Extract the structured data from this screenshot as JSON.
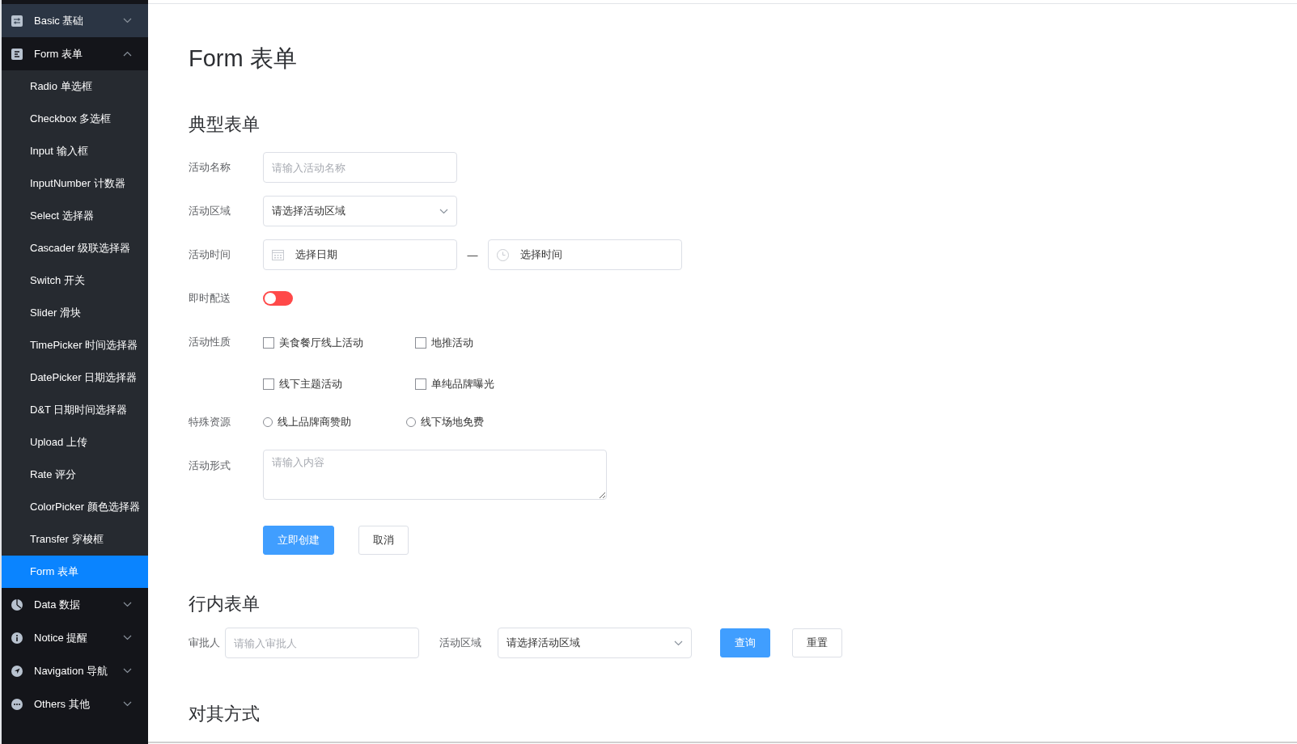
{
  "sidebar": {
    "groups": [
      {
        "label": "Basic 基础",
        "expanded": false
      },
      {
        "label": "Form 表单",
        "expanded": true,
        "children": [
          {
            "label": "Radio 单选框",
            "selected": false
          },
          {
            "label": "Checkbox 多选框",
            "selected": false
          },
          {
            "label": "Input 输入框",
            "selected": false
          },
          {
            "label": "InputNumber 计数器",
            "selected": false
          },
          {
            "label": "Select 选择器",
            "selected": false
          },
          {
            "label": "Cascader 级联选择器",
            "selected": false
          },
          {
            "label": "Switch 开关",
            "selected": false
          },
          {
            "label": "Slider 滑块",
            "selected": false
          },
          {
            "label": "TimePicker 时间选择器",
            "selected": false
          },
          {
            "label": "DatePicker 日期选择器",
            "selected": false
          },
          {
            "label": "D&T 日期时间选择器",
            "selected": false
          },
          {
            "label": "Upload 上传",
            "selected": false
          },
          {
            "label": "Rate 评分",
            "selected": false
          },
          {
            "label": "ColorPicker 颜色选择器",
            "selected": false
          },
          {
            "label": "Transfer 穿梭框",
            "selected": false
          },
          {
            "label": "Form 表单",
            "selected": true
          }
        ]
      },
      {
        "label": "Data 数据",
        "expanded": false
      },
      {
        "label": "Notice 提醒",
        "expanded": false
      },
      {
        "label": "Navigation 导航",
        "expanded": false
      },
      {
        "label": "Others 其他",
        "expanded": false
      }
    ]
  },
  "page_title": "Form 表单",
  "typical_form": {
    "heading": "典型表单",
    "fields": [
      {
        "kind": "input",
        "label": "活动名称",
        "placeholder": "请输入活动名称"
      },
      {
        "kind": "select",
        "label": "活动区域",
        "value": "请选择活动区域"
      },
      {
        "kind": "datetime",
        "label": "活动时间",
        "date_placeholder": "选择日期",
        "separator": "—",
        "time_placeholder": "选择时间"
      },
      {
        "kind": "switch",
        "label": "即时配送",
        "on": false
      },
      {
        "kind": "checkboxes",
        "label": "活动性质",
        "options": [
          {
            "label": "美食餐厅线上活动",
            "checked": false
          },
          {
            "label": "地推活动",
            "checked": false
          },
          {
            "label": "线下主题活动",
            "checked": false
          },
          {
            "label": "单纯品牌曝光",
            "checked": false
          }
        ]
      },
      {
        "kind": "radios",
        "label": "特殊资源",
        "options": [
          {
            "label": "线上品牌商赞助",
            "selected": false
          },
          {
            "label": "线下场地免费",
            "selected": false
          }
        ]
      },
      {
        "kind": "textarea",
        "label": "活动形式",
        "placeholder": "请输入内容"
      }
    ],
    "buttons": [
      {
        "label": "立即创建",
        "kind": "primary"
      },
      {
        "label": "取消",
        "kind": "default"
      }
    ]
  },
  "inline_form": {
    "heading": "行内表单",
    "fields": [
      {
        "kind": "input",
        "label": "审批人",
        "placeholder": "请输入审批人"
      },
      {
        "kind": "select",
        "label": "活动区域",
        "value": "请选择活动区域"
      }
    ],
    "buttons": [
      {
        "label": "查询",
        "kind": "primary"
      },
      {
        "label": "重置",
        "kind": "default"
      }
    ]
  },
  "alignment": {
    "heading": "对其方式"
  }
}
